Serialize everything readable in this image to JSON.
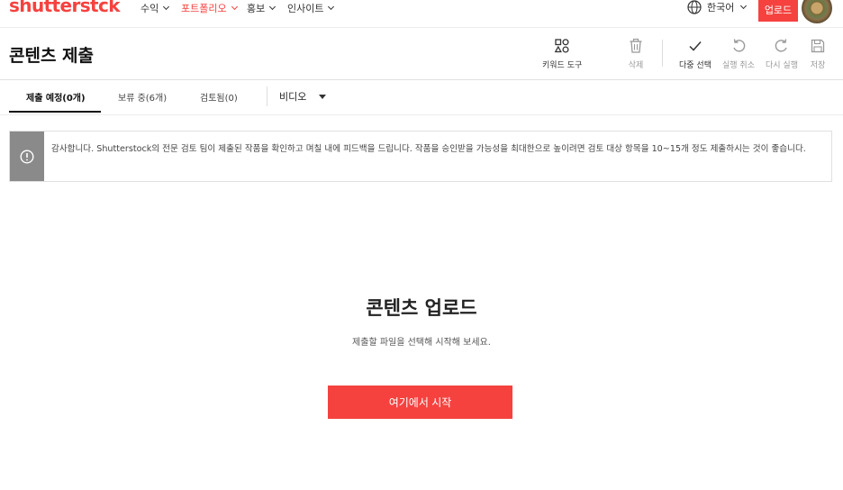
{
  "nav": {
    "logo": "shutterstck",
    "items": [
      {
        "label": "수익"
      },
      {
        "label": "포트폴리오"
      },
      {
        "label": "홍보"
      },
      {
        "label": "인사이트"
      }
    ],
    "language": "한국어",
    "upload_label": "업로드"
  },
  "header": {
    "title": "콘텐츠 제출",
    "tools": {
      "keyword": "키워드 도구",
      "delete": "삭제",
      "multiselect": "다중 선택",
      "undo": "실행 취소",
      "redo": "다시 실행",
      "save": "저장"
    }
  },
  "tabs": [
    {
      "label": "제출 예정(0개)"
    },
    {
      "label": "보류 중(6개)"
    },
    {
      "label": "검토됨(0)"
    }
  ],
  "media_type": "비디오",
  "banner": {
    "text": "감사합니다. Shutterstock의 전문 검토 팀이 제출된 작품을 확인하고 며칠 내에 피드백을 드립니다. 작품을 승인받을 가능성을 최대한으로 높이려면 검토 대상 항목을 10~15개 정도 제출하시는 것이 좋습니다."
  },
  "empty": {
    "title": "콘텐츠 업로드",
    "subtitle": "제출할 파일을 선택해 시작해 보세요.",
    "button": "여기에서 시작"
  },
  "colors": {
    "accent": "#f5423f",
    "banner_icon_bg": "#8a8a8a"
  }
}
